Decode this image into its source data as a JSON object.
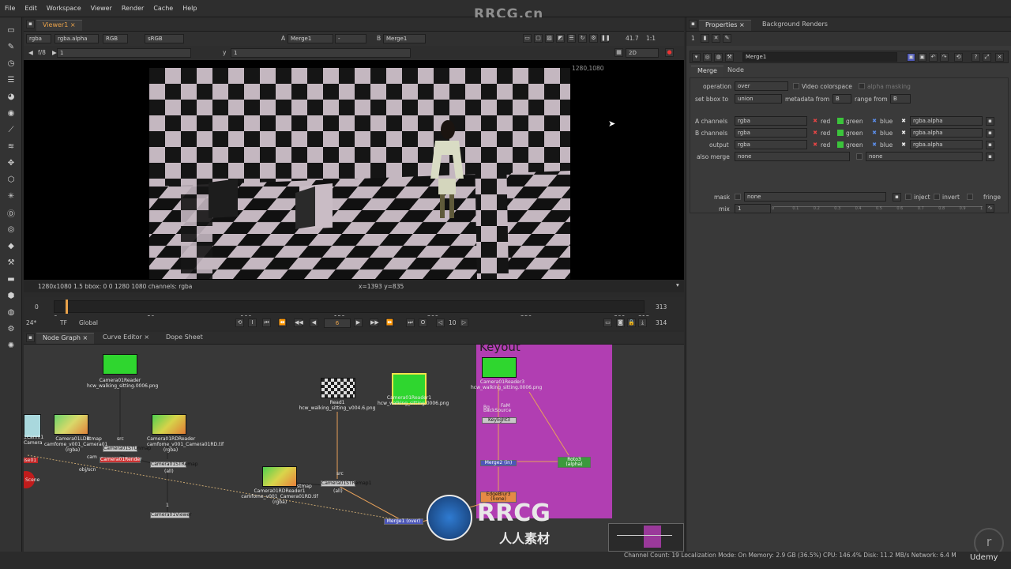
{
  "watermark": "RRCG.cn",
  "menu": [
    "File",
    "Edit",
    "Workspace",
    "Viewer",
    "Render",
    "Cache",
    "Help"
  ],
  "viewer_tab": "Viewer1",
  "viewer_toolbar": {
    "channels": "rgba",
    "alpha": "rgba.alpha",
    "colorspace_mode": "RGB",
    "lut": "sRGB",
    "input_a_label": "A",
    "input_a": "Merge1",
    "input_a_op": "-",
    "input_b_label": "B",
    "input_b": "Merge1",
    "zoom": "41.7",
    "ratio": "1:1",
    "fstop": "f/8",
    "frame_field": "1",
    "y_label": "y",
    "y_value": "1",
    "view_mode": "2D"
  },
  "viewer": {
    "resolution_label": "1280,1080",
    "info_left": "1280x1080 1.5  bbox: 0 0 1280 1080 channels: rgba",
    "info_coords": "x=1393 y=835"
  },
  "timeline": {
    "start": "0",
    "end": "313",
    "end_out": "314",
    "ticks": [
      "0",
      "50",
      "100",
      "150",
      "200",
      "250",
      "300",
      "313"
    ],
    "fps": "24*",
    "tf": "TF",
    "range_mode": "Global",
    "current_frame": "6",
    "step": "10",
    "playhead_fraction": 0.019
  },
  "bottom_tabs": [
    "Node Graph",
    "Curve Editor",
    "Dope Sheet"
  ],
  "nodes": {
    "backdrop_title": "Keyout",
    "cam_reader_top": "Camera01Reader",
    "cam_reader_top_file": "hcw_walking_sitting.0006.png",
    "ldr": "Camera01LDR",
    "ldr_file": "camfome_v001_Camera01",
    "ldr_bar": "(rgba)",
    "stunmap": "Camera01STUnmap",
    "stunmap_port": "stmap",
    "stunmap_src": "src",
    "rdreader": "Camera01RDReader",
    "rdreader_file": "camfome_v001_Camera01RD.tif",
    "rdreader_bar": "(rgba)",
    "render": "Camera01Render",
    "render_cam": "cam",
    "render_obj": "obj/scn",
    "stremap": "Camera01STRemap",
    "stremap_sub": "(all)",
    "viewer_node": "Camera01Viewer",
    "viewer_port": "1",
    "read1": "Read1",
    "read1_file": "hcw_walking_sitting_v004.6.png",
    "reader1": "Camera01Reader1",
    "reader1_file": "hcw_walking_sitting.0006.png",
    "rdreader1": "Camera01RDReader1",
    "rdreader1_file": "camfome_v001_Camera01RD.tif",
    "rdreader1_bar": "(rgba)",
    "stremap1": "Camera01STRemap1",
    "stremap1_port": "stmap",
    "stremap1_src": "src",
    "stremap1_sub": "(all)",
    "merge1": "Merge1 (over)",
    "reader3": "Camera01Reader3",
    "reader3_file": "hcw_walking_sitting.0006.png",
    "backsource": "BackSource",
    "bg": "Bg",
    "fg": "FaM",
    "merge_keyer": "Keylight3",
    "merge2": "Merge2 (in)",
    "roto3": "Roto3",
    "roto3_sub": "(alpha)",
    "edgeblur": "EdgeBlur3",
    "edgeblur_sub": "(none)",
    "cam_left": "1Cam01",
    "cam_left_sub": "Camera",
    "axis_left": "ise01",
    "scene": "Scene"
  },
  "properties": {
    "tabs": [
      "Properties",
      "Background Renders"
    ],
    "count": "1",
    "node_name": "Merge1",
    "node_tabs": [
      "Merge",
      "Node"
    ],
    "operation_label": "operation",
    "operation": "over",
    "video_colorspace": "Video colorspace",
    "alpha_masking": "alpha masking",
    "set_bbox_label": "set bbox to",
    "set_bbox": "union",
    "metadata_label": "metadata from",
    "metadata": "B",
    "range_label": "range from",
    "range": "B",
    "a_channels_label": "A channels",
    "b_channels_label": "B channels",
    "output_label": "output",
    "also_merge_label": "also merge",
    "channel_value": "rgba",
    "red": "red",
    "green": "green",
    "blue": "blue",
    "alpha_channel": "rgba.alpha",
    "also_merge": "none",
    "also_merge2": "none",
    "mask_label": "mask",
    "mask": "none",
    "inject": "inject",
    "invert": "invert",
    "fringe": "fringe",
    "mix_label": "mix",
    "mix": "1",
    "mix_ticks": [
      "0",
      "0.1",
      "0.2",
      "0.3",
      "0.4",
      "0.5",
      "0.6",
      "0.7",
      "0.8",
      "0.9",
      "1"
    ]
  },
  "status": "Channel Count: 19  Localization Mode: On  Memory: 2.9 GB (36.5%)  CPU: 146.4%  Disk: 11.2 MB/s  Network: 6.4 M",
  "brand_logo_text": "RRCG",
  "brand_logo_sub": "人人素材",
  "udemy": "Udemy",
  "colors": {
    "accent": "#e9a24a",
    "backdrop": "#b03fb0",
    "green_thumb": "#2fd62f",
    "node_orange": "#e58a45",
    "node_green": "#3c9a3c",
    "node_blue": "#4d57b8"
  }
}
